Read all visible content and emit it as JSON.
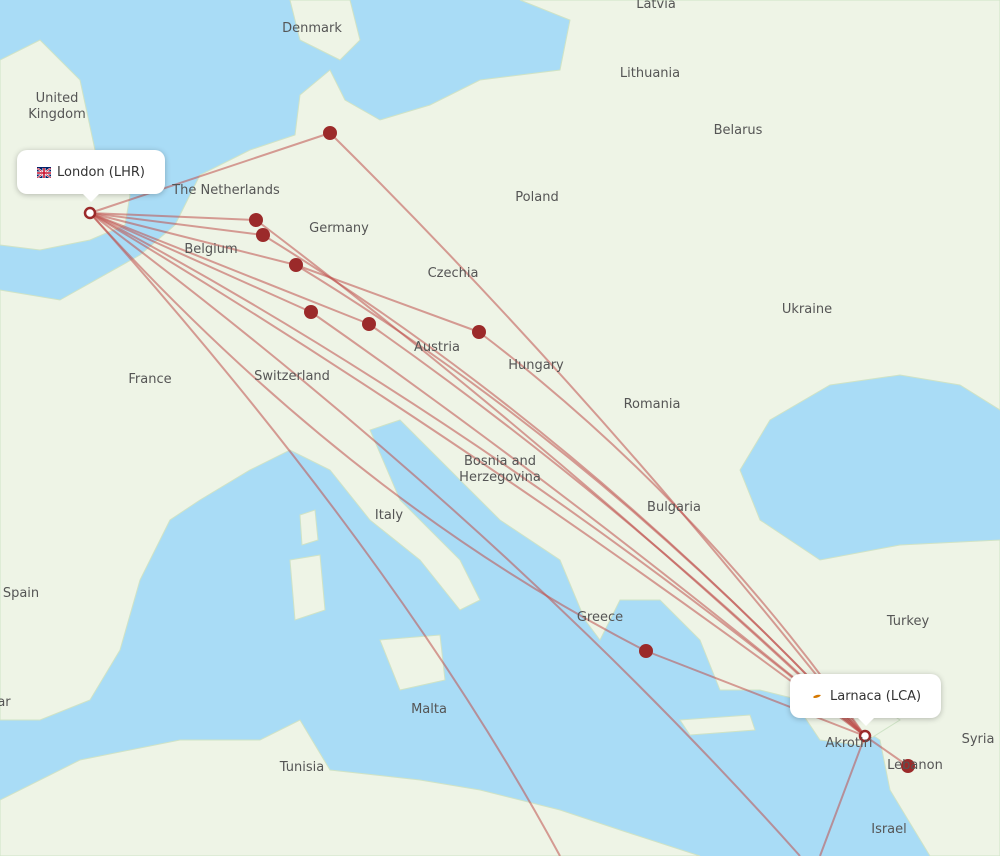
{
  "origin": {
    "label": "London (LHR)",
    "flag": "uk-flag-icon"
  },
  "destination": {
    "label": "Larnaca (LCA)",
    "flag": "cyprus-flag-icon"
  },
  "colors": {
    "route": "#c0504d",
    "dot": "#9b2a2a",
    "sea": "#a9dcf6",
    "land": "#eef4e6",
    "border": "#9fd19a"
  },
  "places": [
    "Latvia",
    "Denmark",
    "Lithuania",
    "United Kingdom",
    "Belarus",
    "The Netherlands",
    "Poland",
    "Germany",
    "Belgium",
    "Czechia",
    "Ukraine",
    "Austria",
    "Hungary",
    "France",
    "Switzerland",
    "Romania",
    "Bosnia and Herzegovina",
    "Bulgaria",
    "Italy",
    "Spain",
    "Turkey",
    "Greece",
    "Malta",
    "Akrotiri",
    "Syria",
    "Tunisia",
    "Lebanon",
    "Israel",
    "ar"
  ]
}
